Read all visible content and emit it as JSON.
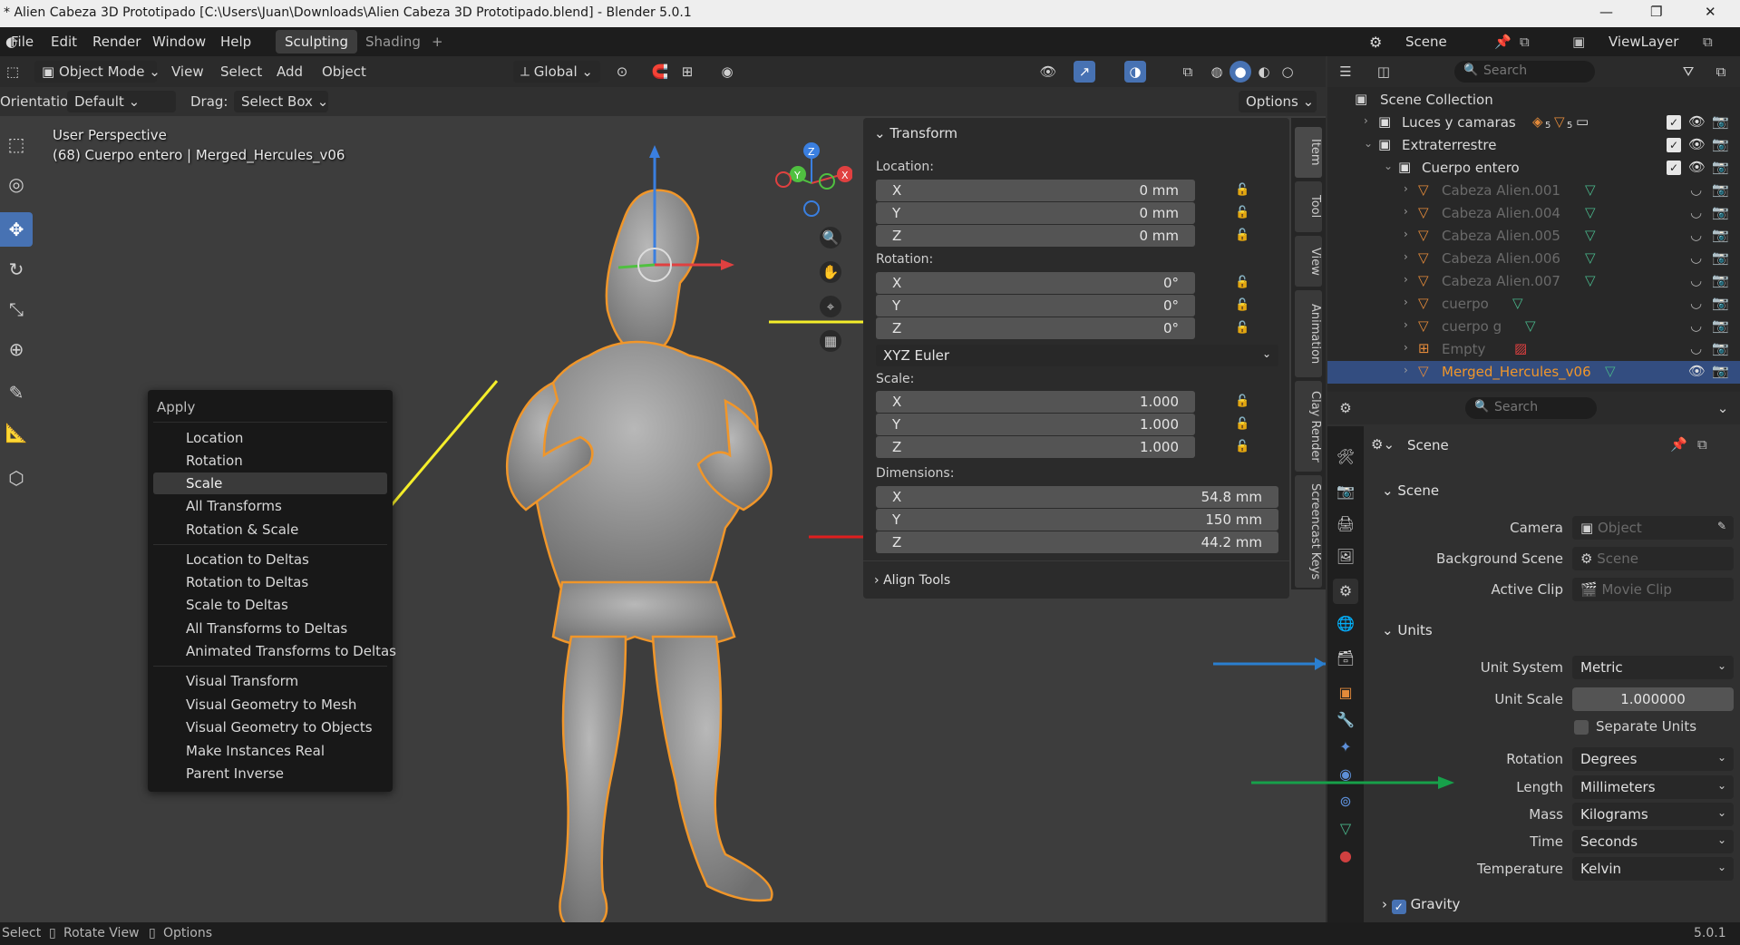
{
  "window": {
    "title": "* Alien Cabeza 3D Prototipado [C:\\Users\\Juan\\Downloads\\Alien Cabeza 3D Prototipado.blend] - Blender 5.0.1",
    "min": "—",
    "max": "❐",
    "close": "✕"
  },
  "menubar": {
    "items": [
      "File",
      "Edit",
      "Render",
      "Window",
      "Help"
    ],
    "tabs": [
      "Sculpting",
      "Shading"
    ],
    "add_tab": "+",
    "scene": "Scene",
    "view_layer": "ViewLayer"
  },
  "viewport_header": {
    "mode": "Object Mode",
    "menus": [
      "View",
      "Select",
      "Add",
      "Object"
    ],
    "orientation_transform": "Global"
  },
  "tool_header": {
    "orientation_label": "Orientation:",
    "orientation_value": "Default",
    "drag_label": "Drag:",
    "drag_value": "Select Box",
    "options": "Options"
  },
  "overlay": {
    "perspective": "User Perspective",
    "object_info": "(68) Cuerpo entero | Merged_Hercules_v06"
  },
  "apply_menu": {
    "title": "Apply",
    "items": [
      "Location",
      "Rotation",
      "Scale",
      "All Transforms",
      "Rotation & Scale",
      "Location to Deltas",
      "Rotation to Deltas",
      "Scale to Deltas",
      "All Transforms to Deltas",
      "Animated Transforms to Deltas",
      "Visual Transform",
      "Visual Geometry to Mesh",
      "Visual Geometry to Objects",
      "Make Instances Real",
      "Parent Inverse"
    ],
    "highlighted": "Scale"
  },
  "transform": {
    "title": "Transform",
    "location_label": "Location:",
    "location": [
      {
        "axis": "X",
        "value": "0 mm"
      },
      {
        "axis": "Y",
        "value": "0 mm"
      },
      {
        "axis": "Z",
        "value": "0 mm"
      }
    ],
    "rotation_label": "Rotation:",
    "rotation": [
      {
        "axis": "X",
        "value": "0°"
      },
      {
        "axis": "Y",
        "value": "0°"
      },
      {
        "axis": "Z",
        "value": "0°"
      }
    ],
    "rotation_mode": "XYZ Euler",
    "scale_label": "Scale:",
    "scale": [
      {
        "axis": "X",
        "value": "1.000"
      },
      {
        "axis": "Y",
        "value": "1.000"
      },
      {
        "axis": "Z",
        "value": "1.000"
      }
    ],
    "dimensions_label": "Dimensions:",
    "dimensions": [
      {
        "axis": "X",
        "value": "54.8 mm"
      },
      {
        "axis": "Y",
        "value": "150 mm"
      },
      {
        "axis": "Z",
        "value": "44.2 mm"
      }
    ],
    "align_tools": "Align Tools"
  },
  "sidebar_tabs": [
    "Item",
    "Tool",
    "View",
    "Animation",
    "Clay Render",
    "Screencast Keys"
  ],
  "outliner": {
    "search_placeholder": "Search",
    "rows": [
      {
        "name": "Scene Collection"
      },
      {
        "name": "Luces y camaras"
      },
      {
        "name": "Extraterrestre"
      },
      {
        "name": "Cuerpo entero"
      },
      {
        "name": "Cabeza Alien.001"
      },
      {
        "name": "Cabeza Alien.004"
      },
      {
        "name": "Cabeza Alien.005"
      },
      {
        "name": "Cabeza Alien.006"
      },
      {
        "name": "Cabeza Alien.007"
      },
      {
        "name": "cuerpo"
      },
      {
        "name": "cuerpo g"
      },
      {
        "name": "Empty"
      },
      {
        "name": "Merged_Hercules_v06"
      }
    ],
    "counts": {
      "luces_a": "5",
      "luces_b": "5"
    }
  },
  "properties": {
    "search_placeholder": "Search",
    "context": "Scene",
    "scene_section": "Scene",
    "camera_label": "Camera",
    "camera_placeholder": "Object",
    "background_label": "Background Scene",
    "background_placeholder": "Scene",
    "clip_label": "Active Clip",
    "clip_placeholder": "Movie Clip",
    "units_section": "Units",
    "unit_system_label": "Unit System",
    "unit_system": "Metric",
    "unit_scale_label": "Unit Scale",
    "unit_scale": "1.000000",
    "separate_units": "Separate Units",
    "rotation_label": "Rotation",
    "rotation": "Degrees",
    "length_label": "Length",
    "length": "Millimeters",
    "mass_label": "Mass",
    "mass": "Kilograms",
    "time_label": "Time",
    "time": "Seconds",
    "temperature_label": "Temperature",
    "temperature": "Kelvin",
    "gravity": "Gravity"
  },
  "statusbar": {
    "select": "Select",
    "rotate": "Rotate View",
    "options": "Options",
    "version": "5.0.1"
  },
  "colors": {
    "yellow_arrow": "#f5ee2a",
    "red_arrow": "#e01e1e",
    "blue_arrow": "#2a7fd0",
    "green_arrow": "#17a04a",
    "selection_outline": "#f0962a",
    "accent": "#4772b3"
  }
}
